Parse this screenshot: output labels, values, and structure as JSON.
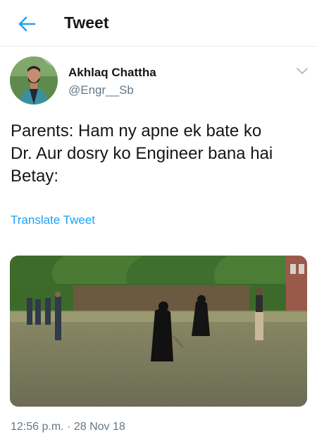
{
  "header": {
    "title": "Tweet",
    "back_icon": "arrow-left-icon",
    "accent": "#1da1f2"
  },
  "tweet": {
    "author_name": "Akhlaq Chattha",
    "author_handle": "@Engr__Sb",
    "text": "Parents: Ham ny apne ek bate ko\nDr. Aur dosry ko Engineer bana hai\nBetay:",
    "translate_label": "Translate Tweet",
    "timestamp": "12:56 p.m. · 28 Nov 18"
  },
  "colors": {
    "text": "#14171a",
    "secondary": "#657786",
    "divider": "#e6ecf0"
  }
}
